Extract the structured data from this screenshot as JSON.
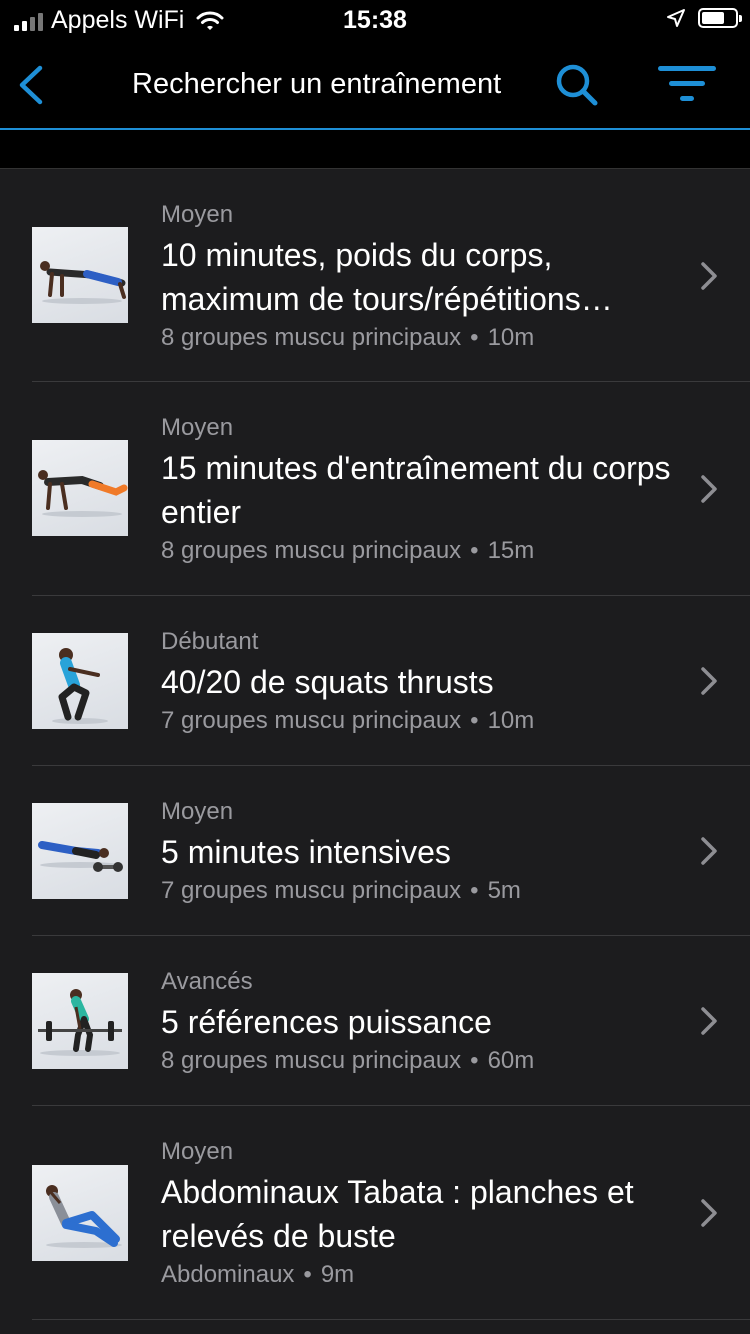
{
  "status_bar": {
    "carrier": "Appels WiFi",
    "time": "15:38",
    "signal_bars_active": 2,
    "battery_level": 0.7
  },
  "nav": {
    "title": "Rechercher un entraînement",
    "accent_color": "#1e8fd6"
  },
  "workouts": [
    {
      "level": "Moyen",
      "title": "10 minutes, poids du corps, maximum de tours/répétitions…",
      "muscles": "8 groupes muscu principaux",
      "duration": "10m",
      "separator": "•"
    },
    {
      "level": "Moyen",
      "title": "15 minutes d'entraînement du corps entier",
      "muscles": "8 groupes muscu principaux",
      "duration": "15m",
      "separator": "•"
    },
    {
      "level": "Débutant",
      "title": "40/20 de squats thrusts",
      "muscles": "7 groupes muscu principaux",
      "duration": "10m",
      "separator": "•"
    },
    {
      "level": "Moyen",
      "title": "5 minutes intensives",
      "muscles": "7 groupes muscu principaux",
      "duration": "5m",
      "separator": "•"
    },
    {
      "level": "Avancés",
      "title": "5 références puissance",
      "muscles": "8 groupes muscu principaux",
      "duration": "60m",
      "separator": "•"
    },
    {
      "level": "Moyen",
      "title": "Abdominaux Tabata : planches et relevés de buste",
      "muscles": "Abdominaux",
      "duration": "9m",
      "separator": "•"
    }
  ]
}
